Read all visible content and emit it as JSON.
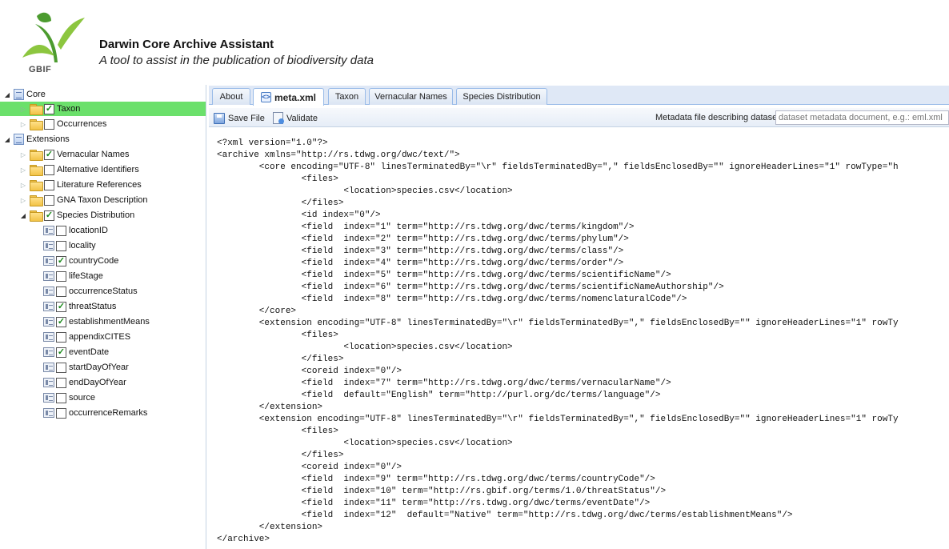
{
  "header": {
    "title": "Darwin Core Archive Assistant",
    "subtitle": "A tool to assist in the publication of biodiversity data",
    "logo_text": "GBIF",
    "logo_colors": {
      "leaf_dark": "#4c9b2f",
      "leaf_light": "#8cc63f"
    }
  },
  "tree": {
    "core": {
      "label": "Core",
      "items": [
        {
          "label": "Taxon",
          "checked": true,
          "selected": true
        },
        {
          "label": "Occurrences",
          "checked": false,
          "selected": false
        }
      ]
    },
    "extensions": {
      "label": "Extensions",
      "items": [
        {
          "label": "Vernacular Names",
          "checked": true
        },
        {
          "label": "Alternative Identifiers",
          "checked": false
        },
        {
          "label": "Literature References",
          "checked": false
        },
        {
          "label": "GNA Taxon Description",
          "checked": false
        },
        {
          "label": "Species Distribution",
          "checked": true
        }
      ]
    },
    "species_fields": [
      {
        "label": "locationID",
        "checked": false
      },
      {
        "label": "locality",
        "checked": false
      },
      {
        "label": "countryCode",
        "checked": true
      },
      {
        "label": "lifeStage",
        "checked": false
      },
      {
        "label": "occurrenceStatus",
        "checked": false
      },
      {
        "label": "threatStatus",
        "checked": true
      },
      {
        "label": "establishmentMeans",
        "checked": true
      },
      {
        "label": "appendixCITES",
        "checked": false
      },
      {
        "label": "eventDate",
        "checked": true
      },
      {
        "label": "startDayOfYear",
        "checked": false
      },
      {
        "label": "endDayOfYear",
        "checked": false
      },
      {
        "label": "source",
        "checked": false
      },
      {
        "label": "occurrenceRemarks",
        "checked": false
      }
    ],
    "selected_color": "#6be06b"
  },
  "tabs": [
    {
      "label": "About",
      "active": false
    },
    {
      "label": "meta.xml",
      "active": true
    },
    {
      "label": "Taxon",
      "active": false
    },
    {
      "label": "Vernacular Names",
      "active": false
    },
    {
      "label": "Species Distribution",
      "active": false
    }
  ],
  "toolbar": {
    "save_label": "Save File",
    "validate_label": "Validate",
    "metadata_label": "Metadata file describing dataset:",
    "metadata_placeholder": "dataset metadata document, e.g.: eml.xml"
  },
  "code_lines": [
    "<?xml version=\"1.0\"?>",
    "<archive xmlns=\"http://rs.tdwg.org/dwc/text/\">",
    "        <core encoding=\"UTF-8\" linesTerminatedBy=\"\\r\" fieldsTerminatedBy=\",\" fieldsEnclosedBy=\"\" ignoreHeaderLines=\"1\" rowType=\"h",
    "                <files>",
    "                        <location>species.csv</location>",
    "                </files>",
    "                <id index=\"0\"/>",
    "                <field  index=\"1\" term=\"http://rs.tdwg.org/dwc/terms/kingdom\"/>",
    "                <field  index=\"2\" term=\"http://rs.tdwg.org/dwc/terms/phylum\"/>",
    "                <field  index=\"3\" term=\"http://rs.tdwg.org/dwc/terms/class\"/>",
    "                <field  index=\"4\" term=\"http://rs.tdwg.org/dwc/terms/order\"/>",
    "                <field  index=\"5\" term=\"http://rs.tdwg.org/dwc/terms/scientificName\"/>",
    "                <field  index=\"6\" term=\"http://rs.tdwg.org/dwc/terms/scientificNameAuthorship\"/>",
    "                <field  index=\"8\" term=\"http://rs.tdwg.org/dwc/terms/nomenclaturalCode\"/>",
    "        </core>",
    "        <extension encoding=\"UTF-8\" linesTerminatedBy=\"\\r\" fieldsTerminatedBy=\",\" fieldsEnclosedBy=\"\" ignoreHeaderLines=\"1\" rowTy",
    "                <files>",
    "                        <location>species.csv</location>",
    "                </files>",
    "                <coreid index=\"0\"/>",
    "                <field  index=\"7\" term=\"http://rs.tdwg.org/dwc/terms/vernacularName\"/>",
    "                <field  default=\"English\" term=\"http://purl.org/dc/terms/language\"/>",
    "        </extension>",
    "        <extension encoding=\"UTF-8\" linesTerminatedBy=\"\\r\" fieldsTerminatedBy=\",\" fieldsEnclosedBy=\"\" ignoreHeaderLines=\"1\" rowTy",
    "                <files>",
    "                        <location>species.csv</location>",
    "                </files>",
    "                <coreid index=\"0\"/>",
    "                <field  index=\"9\" term=\"http://rs.tdwg.org/dwc/terms/countryCode\"/>",
    "                <field  index=\"10\" term=\"http://rs.gbif.org/terms/1.0/threatStatus\"/>",
    "                <field  index=\"11\" term=\"http://rs.tdwg.org/dwc/terms/eventDate\"/>",
    "                <field  index=\"12\"  default=\"Native\" term=\"http://rs.tdwg.org/dwc/terms/establishmentMeans\"/>",
    "        </extension>",
    "</archive>"
  ]
}
